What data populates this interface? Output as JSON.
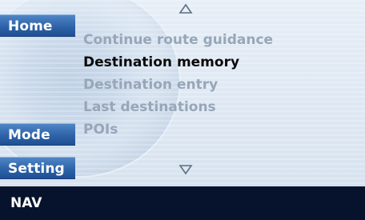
{
  "soft_buttons": {
    "home": "Home",
    "mode": "Mode",
    "setting": "Setting"
  },
  "menu": {
    "items": [
      {
        "label": "Continue route guidance",
        "selected": false
      },
      {
        "label": "Destination memory",
        "selected": true
      },
      {
        "label": "Destination entry",
        "selected": false
      },
      {
        "label": "Last destinations",
        "selected": false
      },
      {
        "label": "POIs",
        "selected": false
      }
    ],
    "scroll_up_icon": "triangle-up-icon",
    "scroll_down_icon": "triangle-down-icon"
  },
  "status_bar": {
    "label": "NAV"
  },
  "colors": {
    "button_blue": "#2e63a8",
    "status_bar_bg": "#07122d",
    "selected_text": "#0a0a0a",
    "unselected_text": "#97a6b8"
  }
}
